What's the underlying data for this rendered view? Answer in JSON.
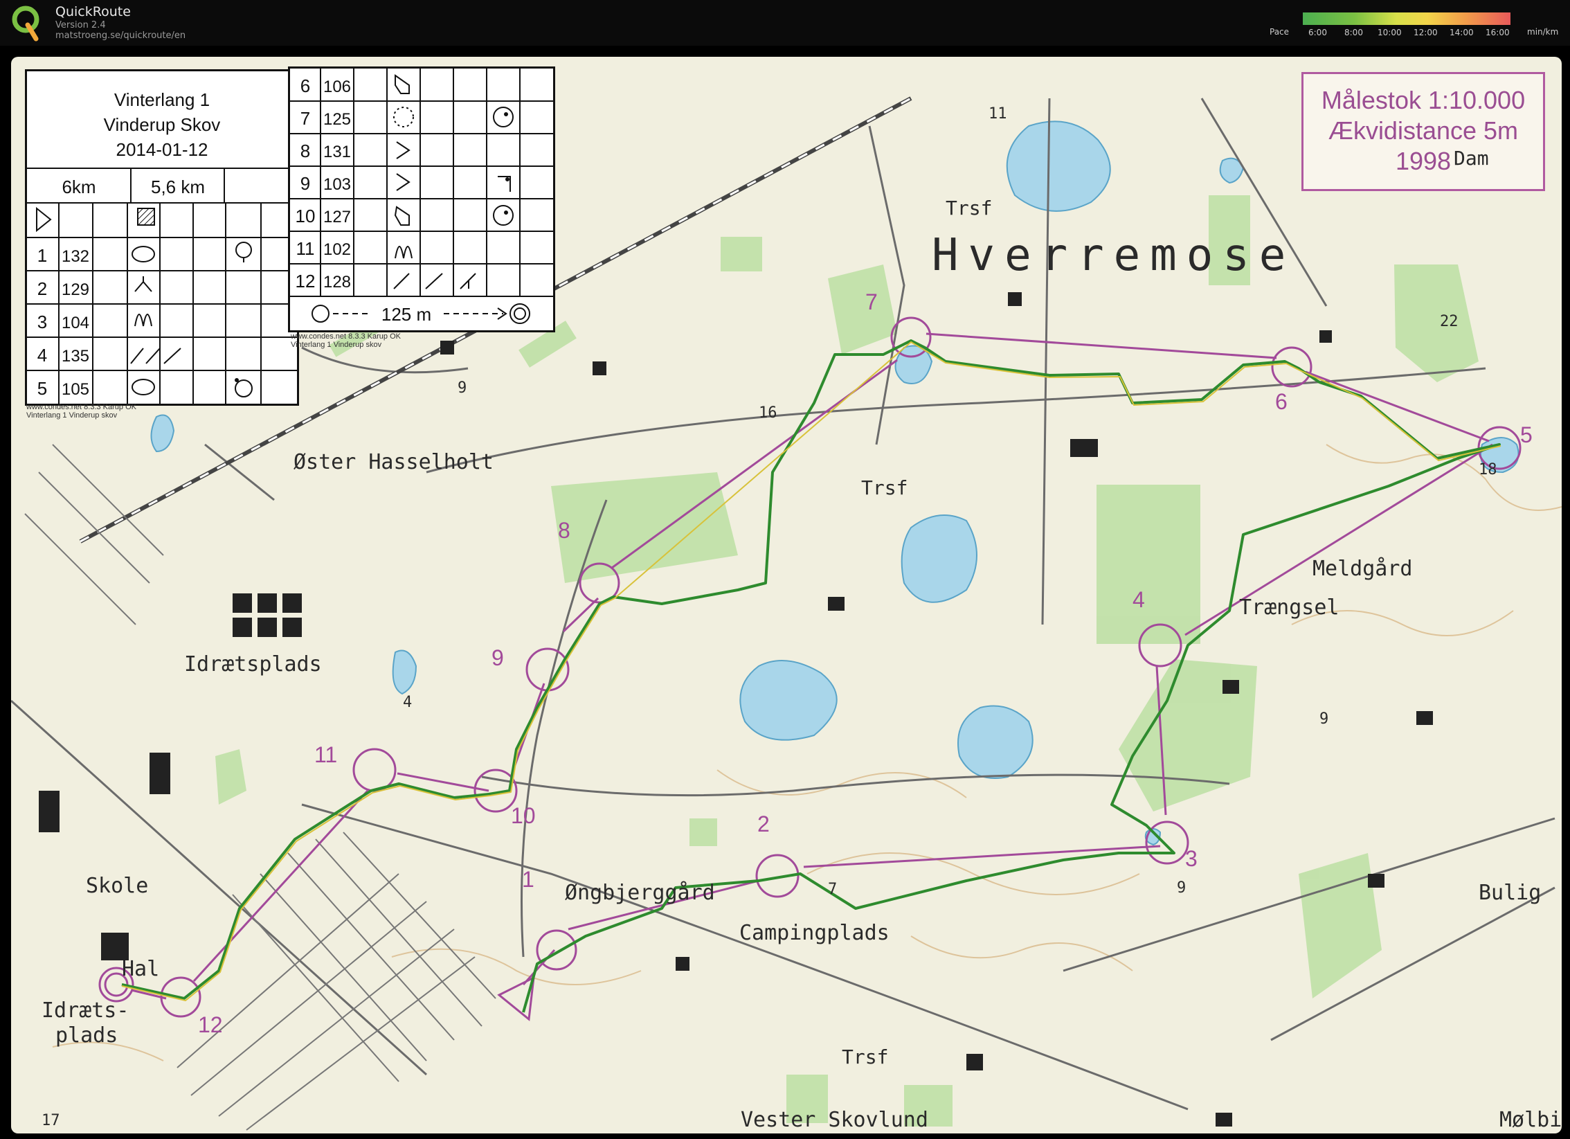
{
  "app": {
    "title": "QuickRoute",
    "version": "Version 2.4",
    "url": "matstroeng.se/quickroute/en",
    "pace_label": "Pace",
    "pace_ticks": [
      "6:00",
      "8:00",
      "10:00",
      "12:00",
      "14:00",
      "16:00"
    ],
    "pace_unit": "min/km"
  },
  "control_card": {
    "event_line1": "Vinterlang 1",
    "event_line2": "Vinderup Skov",
    "event_date": "2014-01-12",
    "distance_a": "6km",
    "distance_b": "5,6 km",
    "finish_distance": "125 m",
    "left_rows": [
      {
        "num": "1",
        "code": "132"
      },
      {
        "num": "2",
        "code": "129"
      },
      {
        "num": "3",
        "code": "104"
      },
      {
        "num": "4",
        "code": "135"
      },
      {
        "num": "5",
        "code": "105"
      }
    ],
    "right_rows": [
      {
        "num": "6",
        "code": "106"
      },
      {
        "num": "7",
        "code": "125"
      },
      {
        "num": "8",
        "code": "131"
      },
      {
        "num": "9",
        "code": "103"
      },
      {
        "num": "10",
        "code": "127"
      },
      {
        "num": "11",
        "code": "102"
      },
      {
        "num": "12",
        "code": "128"
      }
    ],
    "credit_left_1": "www.condes.net 8.3.3 Karup OK",
    "credit_left_2": "Vinterlang 1 Vinderup skov",
    "credit_right_1": "www.condes.net 8.3.3 Karup OK",
    "credit_right_2": "Vinterlang 1 Vinderup skov"
  },
  "scale_box": {
    "line1": "Målestok 1:10.000",
    "line2": "Ækvidistance 5m",
    "line3": "1998"
  },
  "place_names": {
    "hverremose": "Hverremose",
    "oster_hasselholt": "Øster Hasselholt",
    "idraetsplads": "Idrætsplads",
    "meldgard": "Meldgård",
    "traengsel": "Trængsel",
    "ongbjerggard": "Øngbjerggård",
    "campingplads": "Campingplads",
    "skole": "Skole",
    "hal": "Hal",
    "idraets_plads_1": "Idræts-",
    "idraets_plads_2": "plads",
    "bulig": "Bulig",
    "vester_skovlund": "Vester Skovlund",
    "molbi": "Mølbi",
    "trsf_1": "Trsf",
    "trsf_2": "Trsf",
    "trsf_3": "Trsf",
    "dam": "Dam",
    "h11": "11",
    "h9a": "9",
    "h16": "16",
    "h18": "18",
    "h22": "22",
    "h9b": "9",
    "h9c": "9",
    "h4": "4",
    "h7": "7",
    "h17": "17"
  },
  "control_labels": [
    "1",
    "2",
    "3",
    "4",
    "5",
    "6",
    "7",
    "8",
    "9",
    "10",
    "11",
    "12"
  ],
  "colors": {
    "course": "#a24a9a",
    "route_green": "#2e8b2e",
    "route_yellow": "#d8c23a",
    "map_bg": "#f1efdf",
    "forest_green": "#b8dca0",
    "water": "#9fd0e6"
  }
}
